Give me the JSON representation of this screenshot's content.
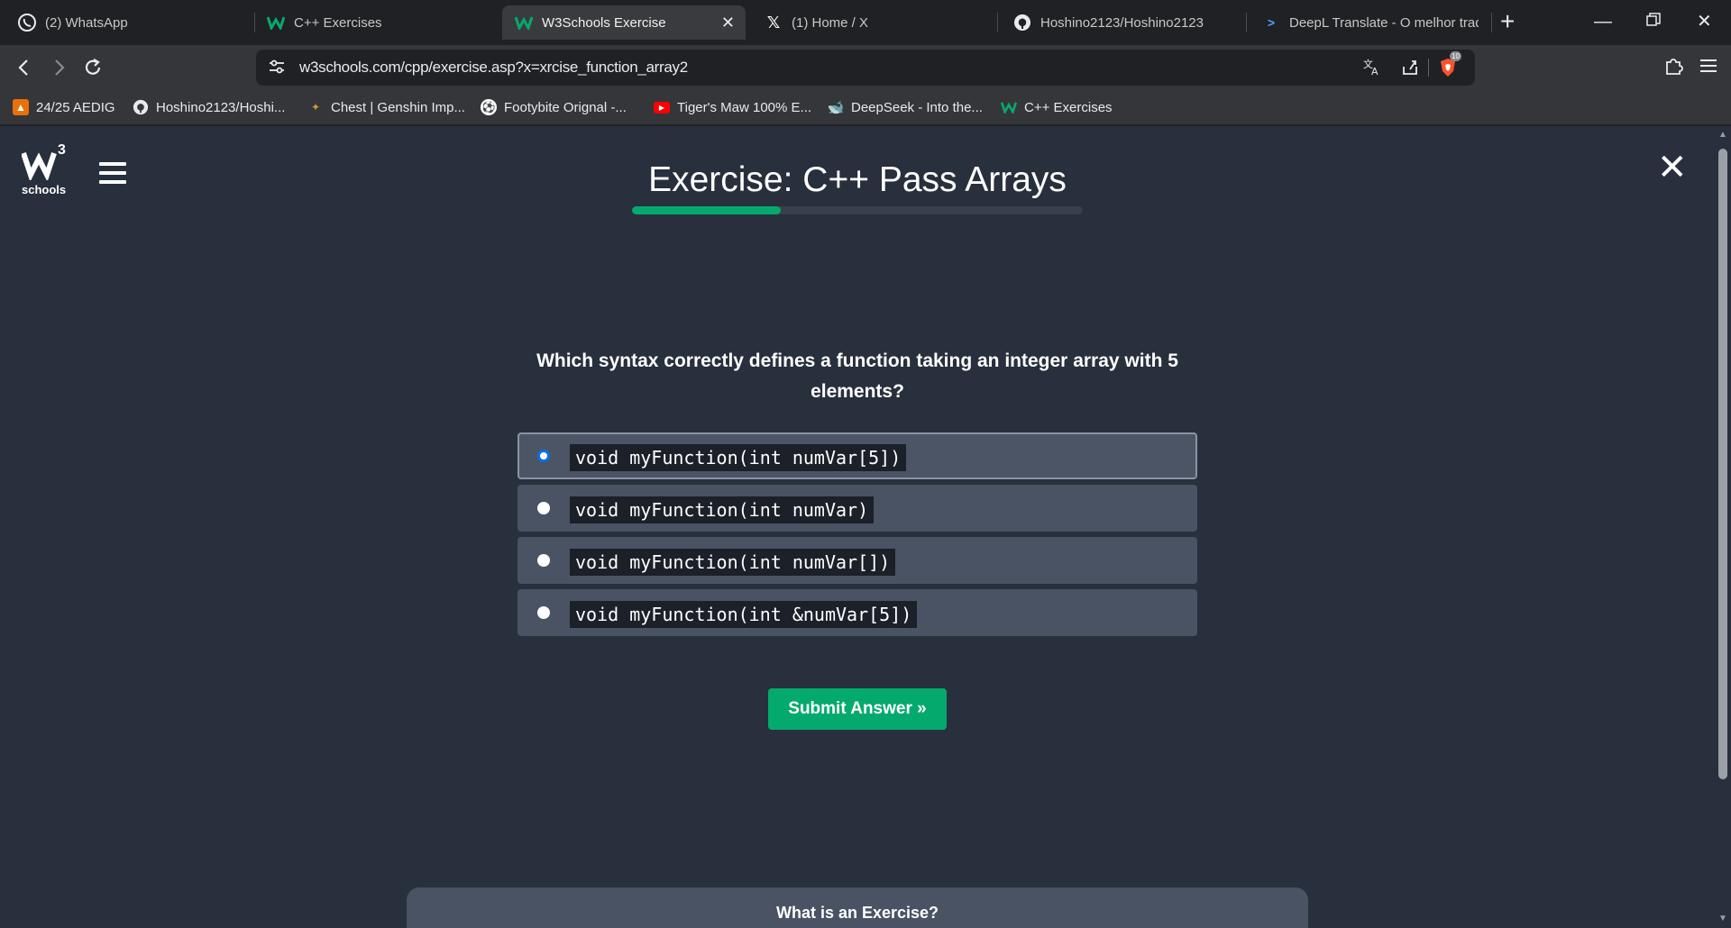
{
  "browser": {
    "tabs": [
      {
        "title": "(2) WhatsApp",
        "icon": "whatsapp-icon",
        "active": false
      },
      {
        "title": "C++ Exercises",
        "icon": "w3schools-icon",
        "active": false
      },
      {
        "title": "W3Schools Exercise",
        "icon": "w3schools-icon",
        "active": true
      },
      {
        "title": "(1) Home / X",
        "icon": "x-icon",
        "active": false
      },
      {
        "title": "Hoshino2123/Hoshino2123",
        "icon": "github-icon",
        "active": false
      },
      {
        "title": "DeepL Translate - O melhor tradu",
        "icon": "deepl-icon",
        "active": false
      }
    ],
    "url": "w3schools.com/cpp/exercise.asp?x=xrcise_function_array2",
    "bookmarks": [
      {
        "label": "24/25 AEDIG",
        "icon": "person-icon",
        "color": "#e8710a"
      },
      {
        "label": "Hoshino2123/Hoshi...",
        "icon": "github-icon",
        "color": "#ffffff"
      },
      {
        "label": "Chest | Genshin Imp...",
        "icon": "chest-icon",
        "color": "#c89b3c"
      },
      {
        "label": "Footybite Orignal -...",
        "icon": "football-icon",
        "color": "#5b6ee1"
      },
      {
        "label": "Tiger's Maw 100% E...",
        "icon": "youtube-icon",
        "color": "#ff0000"
      },
      {
        "label": "DeepSeek - Into the...",
        "icon": "deepseek-icon",
        "color": "#4d6bfe"
      },
      {
        "label": "C++ Exercises",
        "icon": "w3schools-icon",
        "color": "#04aa6d"
      }
    ],
    "brave_badge": "10"
  },
  "page": {
    "logo_sup": "3",
    "logo_text": "schools",
    "title": "Exercise: C++ Pass Arrays",
    "progress_fraction": 0.33,
    "question": "Which syntax correctly defines a function taking an integer array with 5 elements?",
    "options": [
      {
        "code": "void myFunction(int numVar[5])",
        "selected": true
      },
      {
        "code": "void myFunction(int numVar)",
        "selected": false
      },
      {
        "code": "void myFunction(int numVar[])",
        "selected": false
      },
      {
        "code": "void myFunction(int &numVar[5])",
        "selected": false
      }
    ],
    "submit_label": "Submit Answer »",
    "info_title": "What is an Exercise?"
  },
  "colors": {
    "accent": "#04aa6d",
    "page_bg": "#282f3d",
    "option_bg": "#4a5363",
    "radio_selected": "#0b6ee6"
  }
}
